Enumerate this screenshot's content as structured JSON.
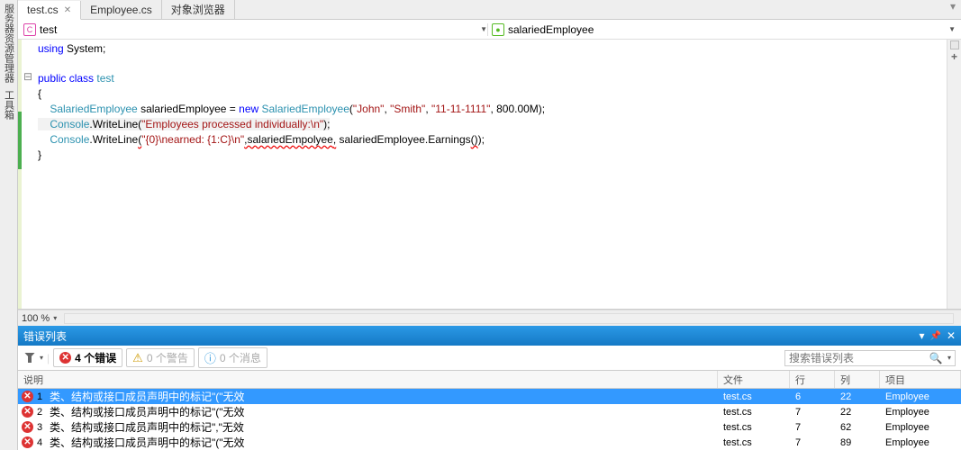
{
  "side": {
    "item1": "服务器资源管理器",
    "item2": "工具箱"
  },
  "tabs": {
    "t1": "test.cs",
    "t2": "Employee.cs",
    "t3": "对象浏览器"
  },
  "nav": {
    "left": "test",
    "right": "salariedEmployee"
  },
  "code": {
    "l1a": "using",
    "l1b": " System;",
    "l3a": "public class",
    "l3b": " test",
    "l4": "{",
    "l5a": "    SalariedEmployee",
    "l5b": " salariedEmployee = ",
    "l5c": "new",
    "l5d": " SalariedEmployee",
    "l5e": "(",
    "l5f": "\"John\"",
    "l5g": ", ",
    "l5h": "\"Smith\"",
    "l5i": ", ",
    "l5j": "\"11-11-1111\"",
    "l5k": ", 800.00M);",
    "l6a": "    Console",
    "l6b": ".WriteLine(",
    "l6c": "\"Employees processed individually:\\n\"",
    "l6d": ");",
    "l7a": "    Console",
    "l7b": ".WriteLine",
    "l7c": "(",
    "l7d": "\"{0}\\nearned: {1:C}\\n\"",
    "l7e": ",salariedEmpolyee",
    "l7f": ",",
    "l7g": " salariedEmployee.Earnings",
    "l7h": "()",
    "l7i": ");",
    "l8": "}"
  },
  "zoom": "100 %",
  "errlist": {
    "title": "错误列表",
    "btn_err": "4 个错误",
    "btn_warn": "0 个警告",
    "btn_info": "0 个消息",
    "search_ph": "搜索错误列表",
    "h_desc": "说明",
    "h_file": "文件",
    "h_line": "行",
    "h_col": "列",
    "h_proj": "项目",
    "rows": [
      {
        "n": "1",
        "d": "类、结构或接口成员声明中的标记\"(\"无效",
        "f": "test.cs",
        "l": "6",
        "c": "22",
        "p": "Employee"
      },
      {
        "n": "2",
        "d": "类、结构或接口成员声明中的标记\"(\"无效",
        "f": "test.cs",
        "l": "7",
        "c": "22",
        "p": "Employee"
      },
      {
        "n": "3",
        "d": "类、结构或接口成员声明中的标记\",\"无效",
        "f": "test.cs",
        "l": "7",
        "c": "62",
        "p": "Employee"
      },
      {
        "n": "4",
        "d": "类、结构或接口成员声明中的标记\"(\"无效",
        "f": "test.cs",
        "l": "7",
        "c": "89",
        "p": "Employee"
      }
    ]
  }
}
